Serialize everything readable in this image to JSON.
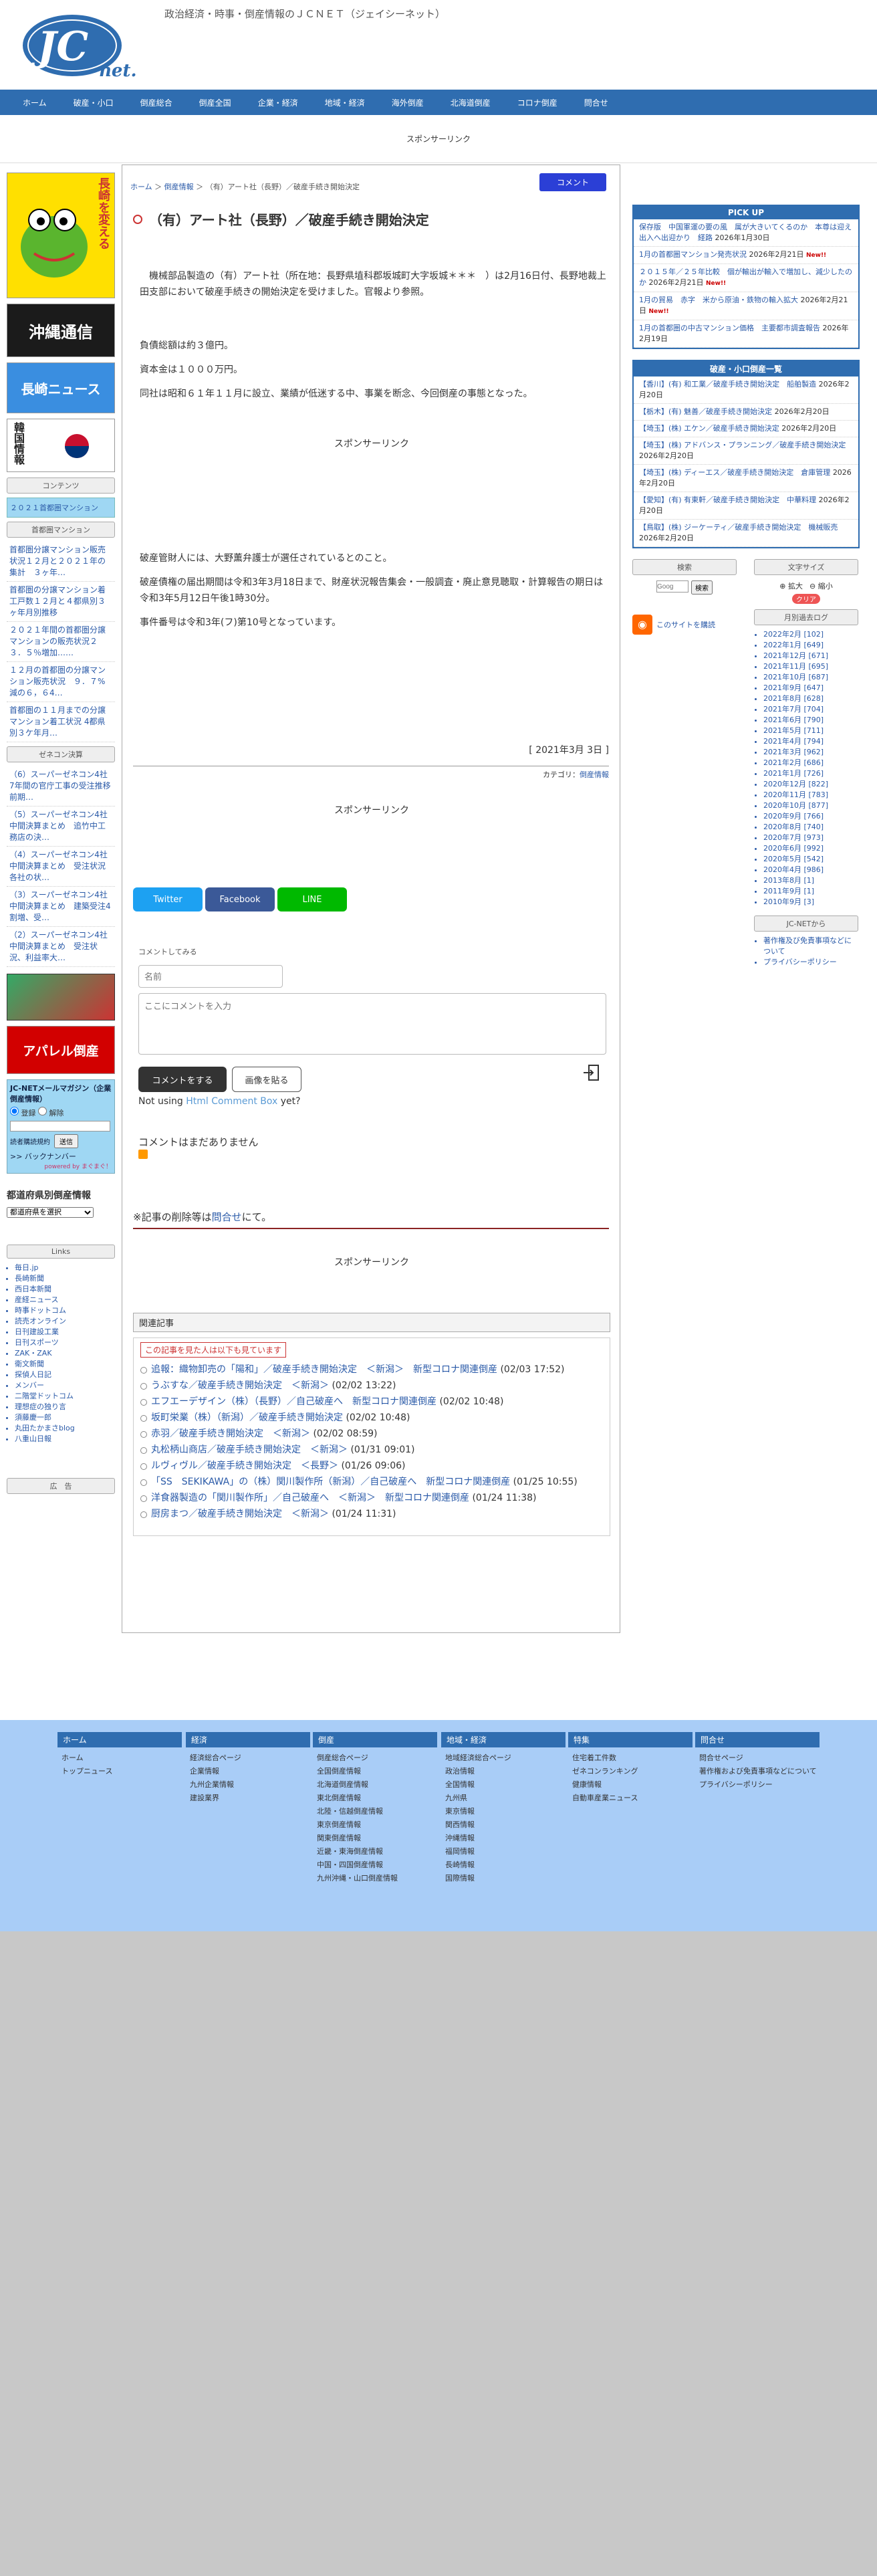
{
  "site": {
    "logo_main": "JC",
    "logo_sub": "net.",
    "tagline": "政治経済・時事・倒産情報のＪＣＮＥＴ（ジェイシーネット）"
  },
  "nav": [
    "ホーム",
    "破産・小口",
    "倒産総合",
    "倒産全国",
    "企業・経済",
    "地域・経済",
    "海外倒産",
    "北海道倒産",
    "コロナ倒産",
    "問合せ"
  ],
  "sponsor_label": "スポンサーリンク",
  "left": {
    "banner1": "長崎を変える",
    "banner2": "沖縄通信",
    "banner3": "長崎ニュース",
    "banner4": "韓国情報",
    "contents_head": "コンテンツ",
    "contents_link": "２０２１首都圏マンション",
    "mansion_head": "首都圏マンション",
    "mansion_links": [
      "首都圏分譲マンション販売状況１２月と２０２１年の集計　３ヶ年…",
      "首都圏の分譲マンション着工戸数１２月と４都県別３ヶ年月別推移",
      "２０２１年間の首都圏分譲マンションの販売状況２３．５％増加……",
      "１２月の首都圏の分譲マンション販売状況　９．７%減の６，６4…",
      "首都圏の１１月までの分譲マンション着工状況 4都県別３ケ年月…"
    ],
    "zeneco_head": "ゼネコン決算",
    "zeneco_links": [
      "（6）スーパーゼネコン4社　7年間の官庁工事の受注推移　前期…",
      "（5）スーパーゼネコン4社中間決算まとめ　追竹中工務店の決…",
      "（4）スーパーゼネコン4社中間決算まとめ　受注状況　各社の状…",
      "（3）スーパーゼネコン4社中間決算まとめ　建築受注4割増、受…",
      "（2）スーパーゼネコン4社中間決算まとめ　受注状況、利益率大…"
    ],
    "banner5": "アパレル倒産",
    "mail_head": "JC-NETメールマガジン（企業倒産情報）",
    "mail_opt1": "登録",
    "mail_opt2": "解除",
    "mail_send": "送信",
    "mail_note": "読者購読規約",
    "backnumber": ">> バックナンバー",
    "powered": "powered by まぐまぐ！",
    "region_head": "都道府県別倒産情報",
    "region_select": "都道府県を選択",
    "links_head": "Links",
    "links": [
      "毎日.jp",
      "長崎新聞",
      "西日本新聞",
      "産経ニュース",
      "時事ドットコム",
      "読売オンライン",
      "日刊建設工業",
      "日刊スポーツ",
      "ZAK・ZAK",
      "衛文新聞",
      "探偵人日記",
      "メンバー",
      "二階堂ドットコム",
      "理想症の独り言",
      "須藤慶一郎",
      "丸田たかまさblog",
      "八重山日報"
    ],
    "ad_label": "広　告"
  },
  "article": {
    "breadcrumb_home": "ホーム",
    "breadcrumb_cat": "倒産情報",
    "breadcrumb_current": "（有）アート社（長野）／破産手続き開始決定",
    "comment_button": "コメント",
    "title": "（有）アート社（長野）／破産手続き開始決定",
    "p1": "　機械部品製造の（有）アート社（所在地：長野県埴科郡坂城町大字坂城＊＊＊　）は2月16日付、長野地裁上田支部において破産手続きの開始決定を受けました。官報より参照。",
    "p2": "負債総額は約３億円。",
    "p3": "資本金は１０００万円。",
    "p4": "同社は昭和６１年１１月に設立、業績が低迷する中、事業を断念、今回倒産の事態となった。",
    "p5": "破産管財人には、大野薫弁護士が選任されているとのこと。",
    "p6": "破産債権の届出期間は令和3年3月18日まで、財産状況報告集会・一般調査・廃止意見聴取・計算報告の期日は令和3年5月12日午後1時30分。",
    "p7": "事件番号は令和3年(フ)第10号となっています。",
    "date": "[ 2021年3月 3日 ]",
    "category_label": "カテゴリ：",
    "category": "倒産情報",
    "share_twitter": "Twitter",
    "share_facebook": "Facebook",
    "share_line": "LINE",
    "comment_heading": "コメントしてみる",
    "name_placeholder": "名前",
    "comment_placeholder": "ここにコメントを入力",
    "submit_button": "コメントをする",
    "image_button": "画像を貼る",
    "not_using": "Not using",
    "hcb_link": "Html Comment Box",
    "yet": "yet?",
    "no_comments": "コメントはまだありません",
    "delete_note": "※記事の削除等は",
    "delete_link": "問合せ",
    "delete_tail": "にて。"
  },
  "related": {
    "head": "関連記事",
    "tag": "この記事を見た人は以下も見ています",
    "items": [
      {
        "title": "追報：織物卸売の「陽和」／破産手続き開始決定　＜新潟＞　新型コロナ関連倒産",
        "date": "(02/03 17:52)"
      },
      {
        "title": "うぶすな／破産手続き開始決定　＜新潟＞",
        "date": "(02/02 13:22)"
      },
      {
        "title": "エフエーデザイン（株）（長野）／自己破産へ　新型コロナ関連倒産",
        "date": "(02/02 10:48)"
      },
      {
        "title": "坂町栄業（株）（新潟）／破産手続き開始決定",
        "date": "(02/02 10:48)"
      },
      {
        "title": "赤羽／破産手続き開始決定　＜新潟＞",
        "date": "(02/02 08:59)"
      },
      {
        "title": "丸松柄山商店／破産手続き開始決定　＜新潟＞",
        "date": "(01/31 09:01)"
      },
      {
        "title": "ルヴィヴル／破産手続き開始決定　＜長野＞",
        "date": "(01/26 09:06)"
      },
      {
        "title": "「SS　SEKIKAWA」の（株）関川製作所（新潟）／自己破産へ　新型コロナ関連倒産",
        "date": "(01/25 10:55)"
      },
      {
        "title": "洋食器製造の「関川製作所」／自己破産へ　＜新潟＞　新型コロナ関連倒産",
        "date": "(01/24 11:38)"
      },
      {
        "title": "厨房まつ／破産手続き開始決定　＜新潟＞",
        "date": "(01/24 11:31)"
      }
    ]
  },
  "right": {
    "pickup_head": "PICK UP",
    "pickup": [
      {
        "title": "保存版　中国軍運の要の風　属が大きいてくるのか　本尊は迎え出入へ出迎かり　経路",
        "date": "2026年1月30日",
        "new": ""
      },
      {
        "title": "1月の首都圏マンション発売状況",
        "date": "2026年2月21日",
        "new": "New!!"
      },
      {
        "title": "２０１５年／２５年比較　個が輸出が輸入で増加し、減少したのか",
        "date": "2026年2月21日",
        "new": "New!!"
      },
      {
        "title": "1月の貿易　赤字　米から原油・鉄物の輸入拡大",
        "date": "2026年2月21日",
        "new": "New!!"
      },
      {
        "title": "1月の首都圏の中古マンション価格　主要都市調査報告",
        "date": "2026年2月19日",
        "new": ""
      }
    ],
    "bankrupt_head": "破産・小口倒産一覧",
    "bankrupt": [
      {
        "title": "【香川】(有) 和工業／破産手続き開始決定　船舶製造",
        "date": "2026年2月20日"
      },
      {
        "title": "【栃木】(有) 魅善／破産手続き開始決定",
        "date": "2026年2月20日"
      },
      {
        "title": "【埼玉】(株) エケン／破産手続き開始決定",
        "date": "2026年2月20日"
      },
      {
        "title": "【埼玉】(株) アドバンス・プランニング／破産手続き開始決定",
        "date": "2026年2月20日"
      },
      {
        "title": "【埼玉】(株) ディーエス／破産手続き開始決定　倉庫管理",
        "date": "2026年2月20日"
      },
      {
        "title": "【愛知】(有) 有東軒／破産手続き開始決定　中華料理",
        "date": "2026年2月20日"
      },
      {
        "title": "【鳥取】(株) ジーケーティ／破産手続き開始決定　機械販売",
        "date": "2026年2月20日"
      }
    ],
    "search_head": "検索",
    "search_placeholder": "Goog",
    "search_button": "検索",
    "font_head": "文字サイズ",
    "font_plus": "拡大",
    "font_minus": "縮小",
    "font_clear": "クリア",
    "rss_link": "このサイトを購読",
    "archive_head": "月別過去ログ",
    "archive": [
      "2022年2月 [102]",
      "2022年1月 [649]",
      "2021年12月 [671]",
      "2021年11月 [695]",
      "2021年10月 [687]",
      "2021年9月 [647]",
      "2021年8月 [628]",
      "2021年7月 [704]",
      "2021年6月 [790]",
      "2021年5月 [711]",
      "2021年4月 [794]",
      "2021年3月 [962]",
      "2021年2月 [686]",
      "2021年1月 [726]",
      "2020年12月 [822]",
      "2020年11月 [783]",
      "2020年10月 [877]",
      "2020年9月 [766]",
      "2020年8月 [740]",
      "2020年7月 [973]",
      "2020年6月 [992]",
      "2020年5月 [542]",
      "2020年4月 [986]",
      "2013年8月 [1]",
      "2011年9月 [1]",
      "2010年9月 [3]"
    ],
    "jcnet_head": "JC-NETから",
    "jcnet_links": [
      "著作権及び免責事項などについて",
      "プライバシーポリシー"
    ]
  },
  "footer": [
    {
      "head": "ホーム",
      "links": [
        "ホーム",
        "トップニュース"
      ]
    },
    {
      "head": "経済",
      "links": [
        "経済総合ページ",
        "企業情報",
        "九州企業情報",
        "建設業界"
      ]
    },
    {
      "head": "倒産",
      "links": [
        "倒産総合ページ",
        "全国倒産情報",
        "北海道倒産情報",
        "東北倒産情報",
        "北陸・信越倒産情報",
        "東京倒産情報",
        "関東倒産情報",
        "近畿・東海倒産情報",
        "中国・四国倒産情報",
        "九州沖縄・山口倒産情報"
      ]
    },
    {
      "head": "地域・経済",
      "links": [
        "地域経済総合ページ",
        "政治情報",
        "全国情報",
        "九州県",
        "東京情報",
        "関西情報",
        "沖縄情報",
        "福岡情報",
        "長崎情報",
        "国際情報"
      ]
    },
    {
      "head": "特集",
      "links": [
        "住宅着工件数",
        "ゼネコンランキング",
        "健康情報",
        "自動車産業ニュース"
      ]
    },
    {
      "head": "問合せ",
      "links": [
        "問合せページ",
        "著作権および免責事項などについて",
        "プライバシーポリシー"
      ]
    }
  ]
}
